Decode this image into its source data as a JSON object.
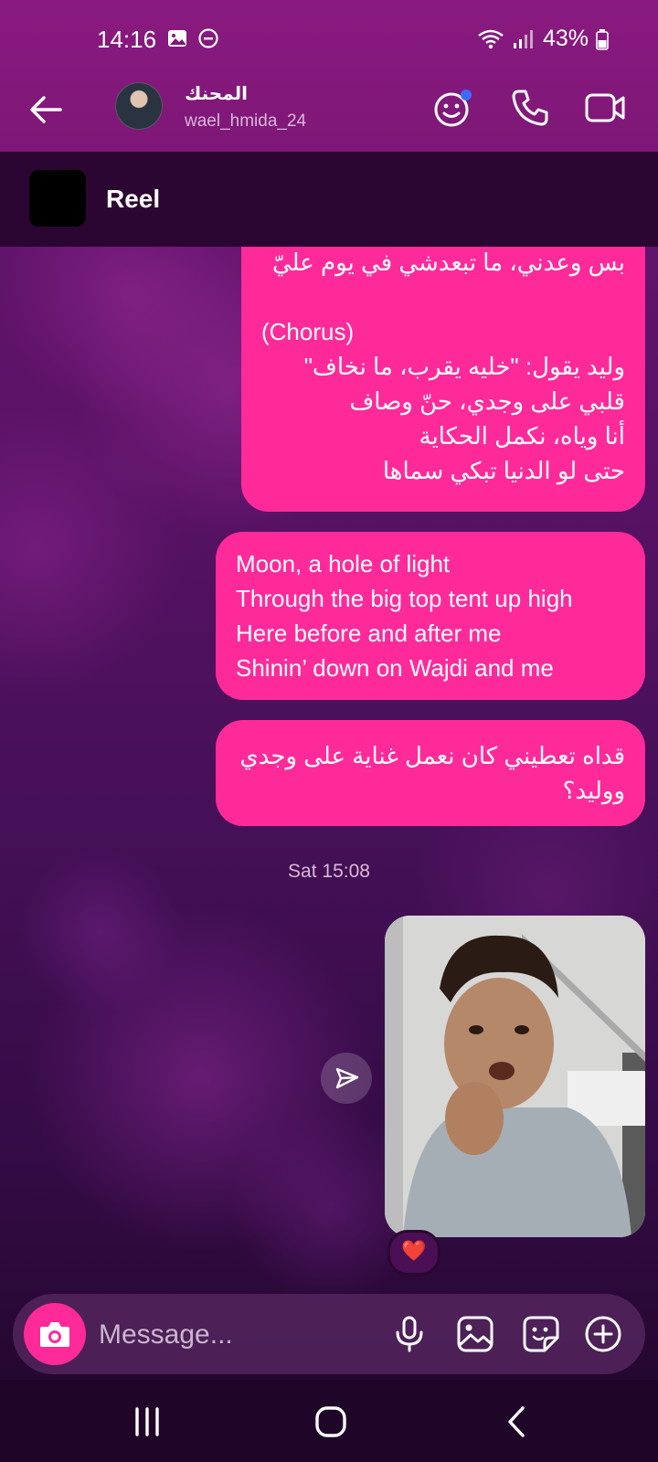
{
  "status": {
    "time": "14:16",
    "battery": "43%"
  },
  "header": {
    "contact_name": "المحنك",
    "username": "wael_hmida_24"
  },
  "reel": {
    "label": "Reel"
  },
  "messages": {
    "arabic_lyrics": [
      "بس وعدني، ما تبعدشي في يوم عليّ",
      "",
      "(Chorus)",
      "وليد يقول: \"خليه يقرب، ما نخاف\"",
      "قلبي على وجدي، حنّ وصاف",
      "أنا وياه، نكمل الحكاية",
      "حتى لو الدنيا تبكي سماها"
    ],
    "english_lyrics": [
      "Moon, a hole of light",
      "Through the big top tent up high",
      "Here before and after me",
      "Shinin’ down on Wajdi and me"
    ],
    "question": [
      "قداه تعطيني كان نعمل غناية على وجدي",
      "ووليد؟"
    ],
    "timestamp": "Sat 15:08",
    "reaction": "❤️"
  },
  "composer": {
    "placeholder": "Message..."
  },
  "colors": {
    "bubble": "#ff2a9a",
    "header": "#8a1a80",
    "accent_dot": "#3d6bff"
  },
  "icons": [
    "back-arrow-icon",
    "theme-face-icon",
    "phone-icon",
    "video-icon",
    "camera-icon",
    "mic-icon",
    "gallery-icon",
    "sticker-icon",
    "plus-icon",
    "send-icon"
  ]
}
